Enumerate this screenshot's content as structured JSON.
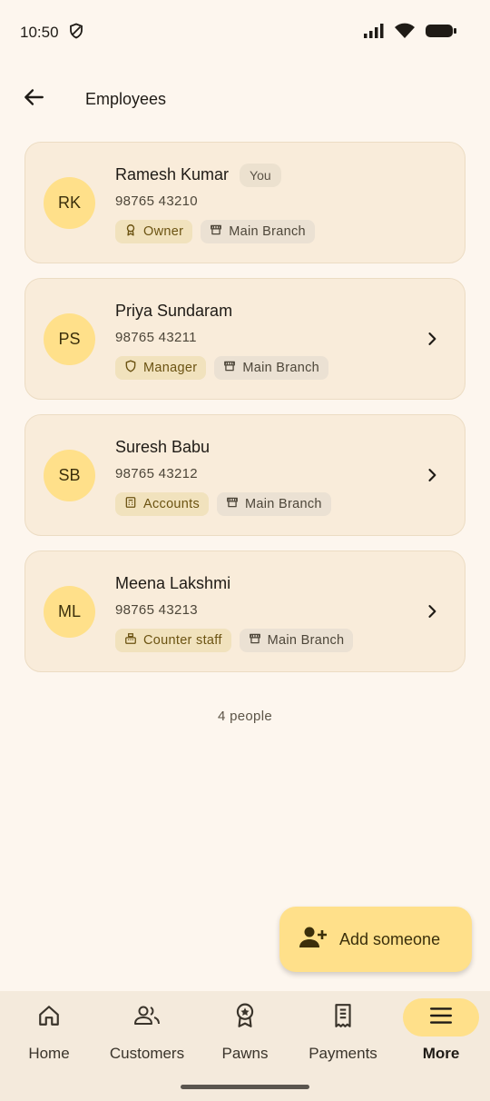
{
  "status_bar": {
    "time": "10:50"
  },
  "header": {
    "title": "Employees"
  },
  "employees": [
    {
      "initials": "RK",
      "name": "Ramesh Kumar",
      "badge": "You",
      "phone": "98765 43210",
      "role": "Owner",
      "branch": "Main Branch"
    },
    {
      "initials": "PS",
      "name": "Priya Sundaram",
      "phone": "98765 43211",
      "role": "Manager",
      "branch": "Main Branch"
    },
    {
      "initials": "SB",
      "name": "Suresh Babu",
      "phone": "98765 43212",
      "role": "Accounts",
      "branch": "Main Branch"
    },
    {
      "initials": "ML",
      "name": "Meena Lakshmi",
      "phone": "98765 43213",
      "role": "Counter staff",
      "branch": "Main Branch"
    }
  ],
  "count_text": "4 people",
  "fab": {
    "label": "Add someone",
    "icon": "person-add-icon"
  },
  "nav": {
    "items": [
      {
        "label": "Home",
        "icon": "home-icon"
      },
      {
        "label": "Customers",
        "icon": "people-icon"
      },
      {
        "label": "Pawns",
        "icon": "badge-star-icon"
      },
      {
        "label": "Payments",
        "icon": "receipt-icon"
      },
      {
        "label": "More",
        "icon": "menu-icon",
        "active": true
      }
    ]
  },
  "colors": {
    "background": "#fdf6ee",
    "card": "#f9ecda",
    "accent": "#ffe08a",
    "role_chip": "#f1e2bd",
    "branch_chip": "#ebe1d3"
  }
}
